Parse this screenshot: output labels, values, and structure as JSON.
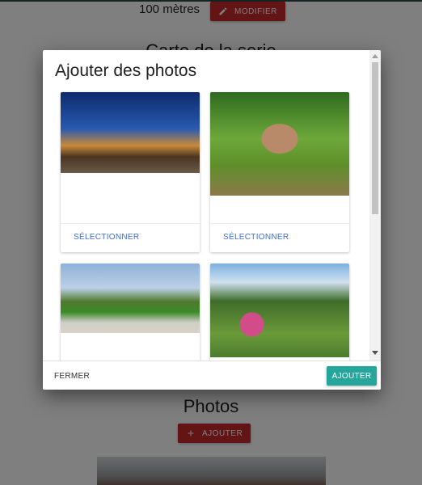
{
  "background": {
    "distance_label": "100 mètres",
    "modify_button": "MODIFIER",
    "section_map_title": "Carte de la serie",
    "section_photos_title": "Photos",
    "add_button": "AJOUTER"
  },
  "modal": {
    "title": "Ajouter des photos",
    "cards": [
      {
        "select_label": "SÉLECTIONNER"
      },
      {
        "select_label": "SÉLECTIONNER"
      },
      {
        "select_label": ""
      },
      {
        "select_label": ""
      }
    ],
    "close_button": "FERMER",
    "confirm_button": "AJOUTER"
  },
  "colors": {
    "primary_red": "#c62828",
    "accent_teal": "#26a69a",
    "link_blue": "#3f6bd8"
  },
  "icons": {
    "modify": "pencil-icon",
    "add": "plus-icon"
  }
}
